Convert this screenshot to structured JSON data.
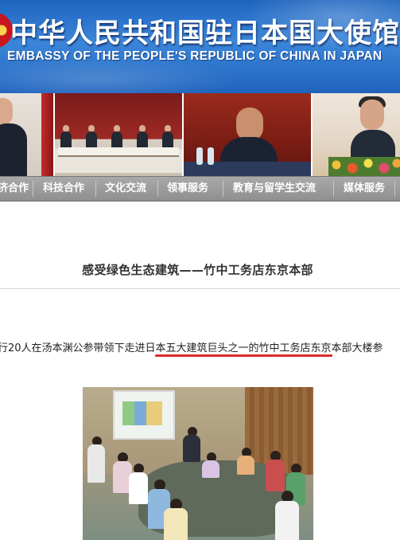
{
  "banner": {
    "title_cn": "中华人民共和国驻日本国大使馆",
    "title_en": "EMBASSY OF THE PEOPLE'S REPUBLIC OF CHINA IN JAPAN"
  },
  "nav": {
    "items": [
      {
        "label": "济合作"
      },
      {
        "label": "科技合作"
      },
      {
        "label": "文化交流"
      },
      {
        "label": "领事服务"
      },
      {
        "label": "教育与留学生交流"
      },
      {
        "label": "媒体服务"
      }
    ]
  },
  "article": {
    "title": "感受绿色生态建筑——竹中工务店东京本部",
    "body_line": "行20人在汤本渊公参带领下走进日本五大建筑巨头之一的竹中工务店东京本部大楼参"
  },
  "colors": {
    "banner_blue": "#2f78d0",
    "nav_gray": "#9a9a9a",
    "highlight_red": "#dd2b2b"
  }
}
